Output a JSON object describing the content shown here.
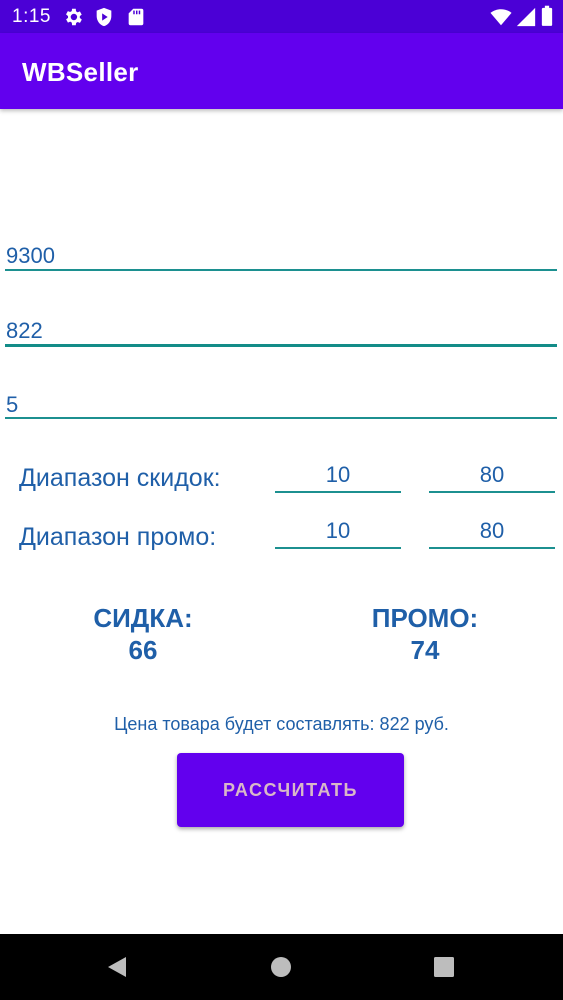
{
  "status_bar": {
    "time": "1:15",
    "icons": [
      "gear-icon",
      "play-shield-icon",
      "sd-card-icon",
      "wifi-icon",
      "signal-icon",
      "battery-icon"
    ]
  },
  "app_bar": {
    "title": "WBSeller"
  },
  "form": {
    "price_value": "9300",
    "cost_value": "822",
    "quantity_value": "5"
  },
  "ranges": {
    "discount_label": "Диапазон скидок:",
    "discount_min": "10",
    "discount_max": "80",
    "promo_label": "Диапазон промо:",
    "promo_min": "10",
    "promo_max": "80"
  },
  "results": {
    "discount_label": "СИДКА:",
    "discount_value": "66",
    "promo_label": "ПРОМО:",
    "promo_value": "74"
  },
  "message": "Цена товара будет составлять: 822 руб.",
  "button": {
    "calculate_label": "РАССЧИТАТЬ"
  },
  "colors": {
    "status_bar": "#4b00d6",
    "app_bar": "#6200ee",
    "text": "#1f5fa8",
    "underline": "#1c9090"
  }
}
